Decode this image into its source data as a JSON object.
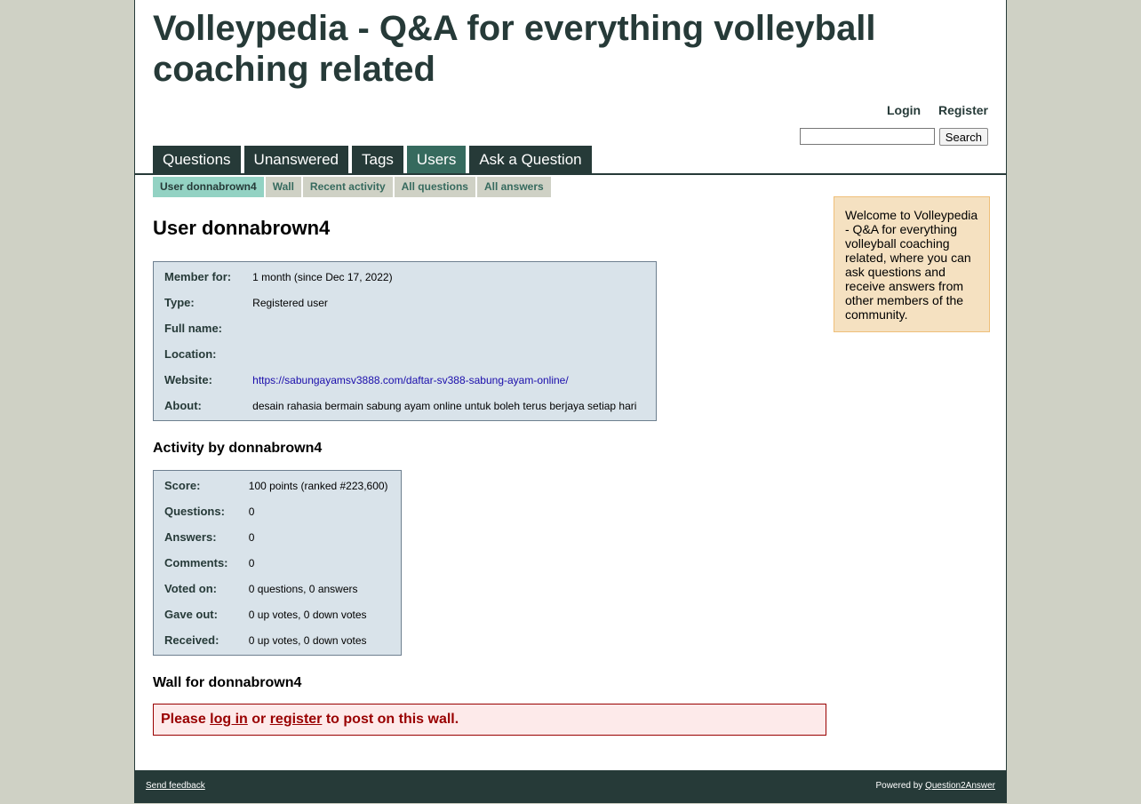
{
  "site": {
    "title": "Volleypedia - Q&A for everything volleyball coaching related"
  },
  "user_nav": {
    "login": "Login",
    "register": "Register"
  },
  "search": {
    "button": "Search",
    "value": ""
  },
  "main_nav": [
    "Questions",
    "Unanswered",
    "Tags",
    "Users",
    "Ask a Question"
  ],
  "main_nav_active": "Users",
  "sub_nav": [
    "User donnabrown4",
    "Wall",
    "Recent activity",
    "All questions",
    "All answers"
  ],
  "sub_nav_active": "User donnabrown4",
  "sidebar": {
    "welcome": "Welcome to Volleypedia - Q&A for everything volleyball coaching related, where you can ask questions and receive answers from other members of the community."
  },
  "profile": {
    "heading": "User donnabrown4",
    "rows": [
      {
        "label": "Member for:",
        "value": "1 month (since Dec 17, 2022)"
      },
      {
        "label": "Type:",
        "value": "Registered user"
      },
      {
        "label": "Full name:",
        "value": ""
      },
      {
        "label": "Location:",
        "value": ""
      },
      {
        "label": "Website:",
        "value": "https://sabungayamsv3888.com/daftar-sv388-sabung-ayam-online/"
      },
      {
        "label": "About:",
        "value": "desain rahasia bermain sabung ayam online untuk boleh terus berjaya setiap hari"
      }
    ]
  },
  "activity": {
    "heading": "Activity by donnabrown4",
    "rows": [
      {
        "label": "Score:",
        "value": "100 points (ranked #223,600)"
      },
      {
        "label": "Questions:",
        "value": "0"
      },
      {
        "label": "Answers:",
        "value": "0"
      },
      {
        "label": "Comments:",
        "value": "0"
      },
      {
        "label": "Voted on:",
        "value": "0 questions, 0 answers"
      },
      {
        "label": "Gave out:",
        "value": "0 up votes, 0 down votes"
      },
      {
        "label": "Received:",
        "value": "0 up votes, 0 down votes"
      }
    ]
  },
  "wall": {
    "heading": "Wall for donnabrown4",
    "prefix": "Please ",
    "login_link": "log in",
    "middle": " or ",
    "register_link": "register",
    "suffix": " to post on this wall."
  },
  "footer": {
    "feedback": "Send feedback",
    "powered_prefix": "Powered by ",
    "powered_link": "Question2Answer"
  }
}
